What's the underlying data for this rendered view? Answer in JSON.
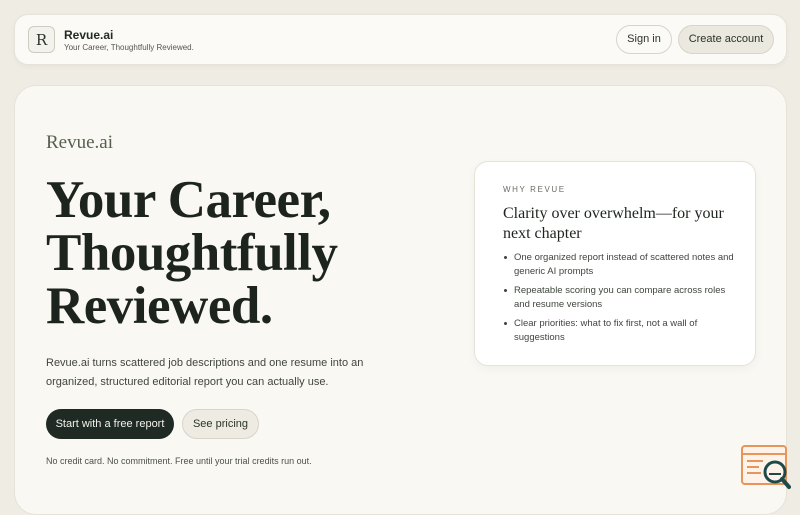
{
  "header": {
    "logo_letter": "R",
    "brand_name": "Revue.ai",
    "tagline": "Your Career, Thoughtfully Reviewed.",
    "signin_label": "Sign in",
    "create_label": "Create account"
  },
  "hero": {
    "brand": "Revue.ai",
    "title_line1": "Your Career,",
    "title_line2": "Thoughtfully",
    "title_line3": "Reviewed.",
    "subtitle": "Revue.ai turns scattered job descriptions and one resume into an organized, structured editorial report you can actually use.",
    "start_label": "Start with a free report",
    "pricing_label": "See pricing",
    "fineprint": "No credit card. No commitment. Free until your trial credits run out."
  },
  "card": {
    "eyebrow": "WHY REVUE",
    "title": "Clarity over overwhelm—for your next chapter",
    "items": [
      "One organized report instead of scattered notes and generic AI prompts",
      "Repeatable scoring you can compare across roles and resume versions",
      "Clear priorities: what to fix first, not a wall of suggestions"
    ]
  },
  "widget": {
    "icon": "report-search-icon"
  },
  "colors": {
    "background": "#efece4",
    "primary_button": "#1e2a23",
    "widget_accent": "#e8955a",
    "widget_dark": "#1f4a4a"
  }
}
